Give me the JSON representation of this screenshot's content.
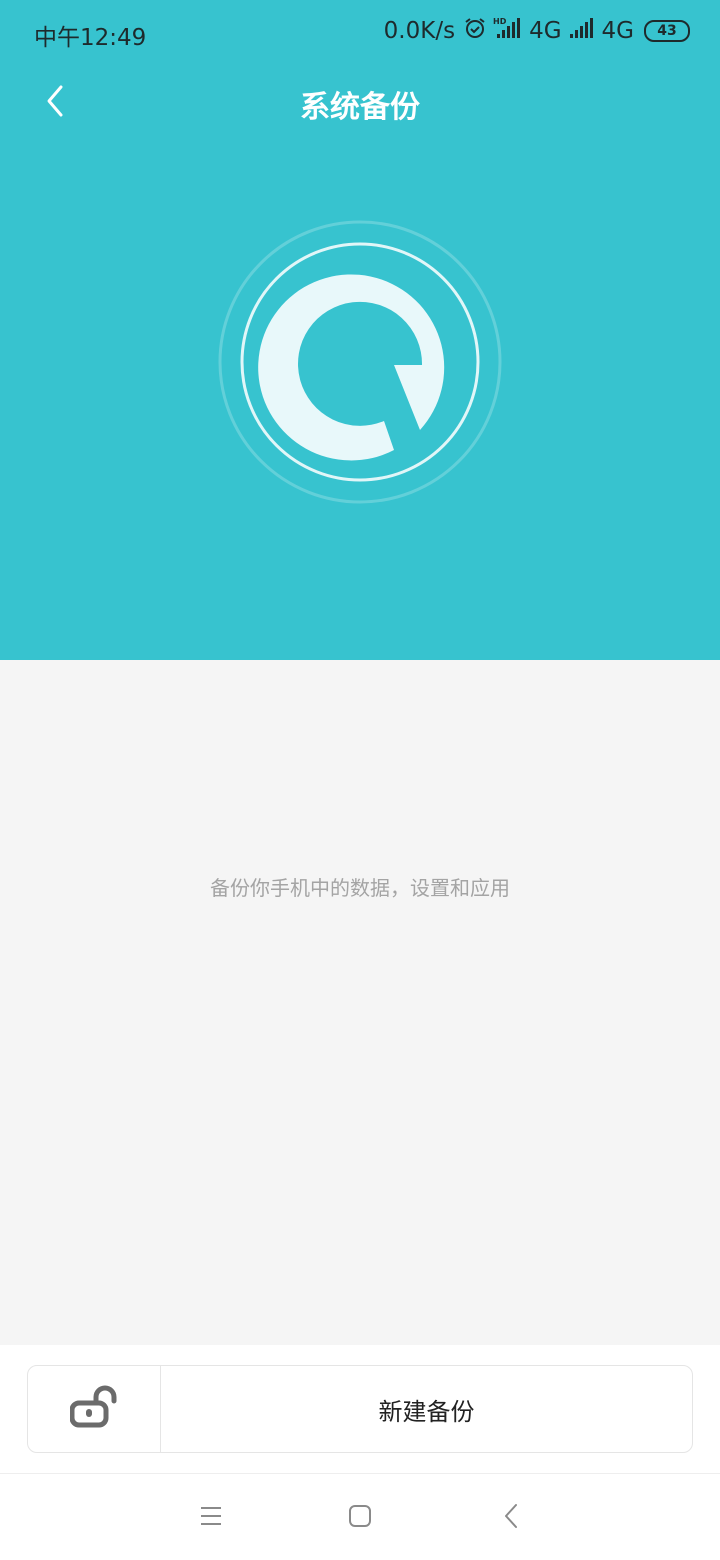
{
  "status_bar": {
    "time": "中午12:49",
    "net_speed": "0.0K/s",
    "sim1_network": "4G",
    "sim2_network": "4G",
    "battery": "43",
    "icons": [
      "alarm-icon",
      "hd-signal-icon",
      "signal-icon"
    ]
  },
  "header": {
    "title": "系统备份",
    "back_icon": "chevron-left-icon"
  },
  "hero": {
    "logo_icon": "backup-logo-icon",
    "accent_color": "#37c3cf"
  },
  "main": {
    "description": "备份你手机中的数据，设置和应用"
  },
  "bottom": {
    "lock_icon": "unlock-icon",
    "new_backup_label": "新建备份"
  },
  "system_nav": {
    "icons": [
      "menu-icon",
      "home-icon",
      "back-icon"
    ]
  }
}
